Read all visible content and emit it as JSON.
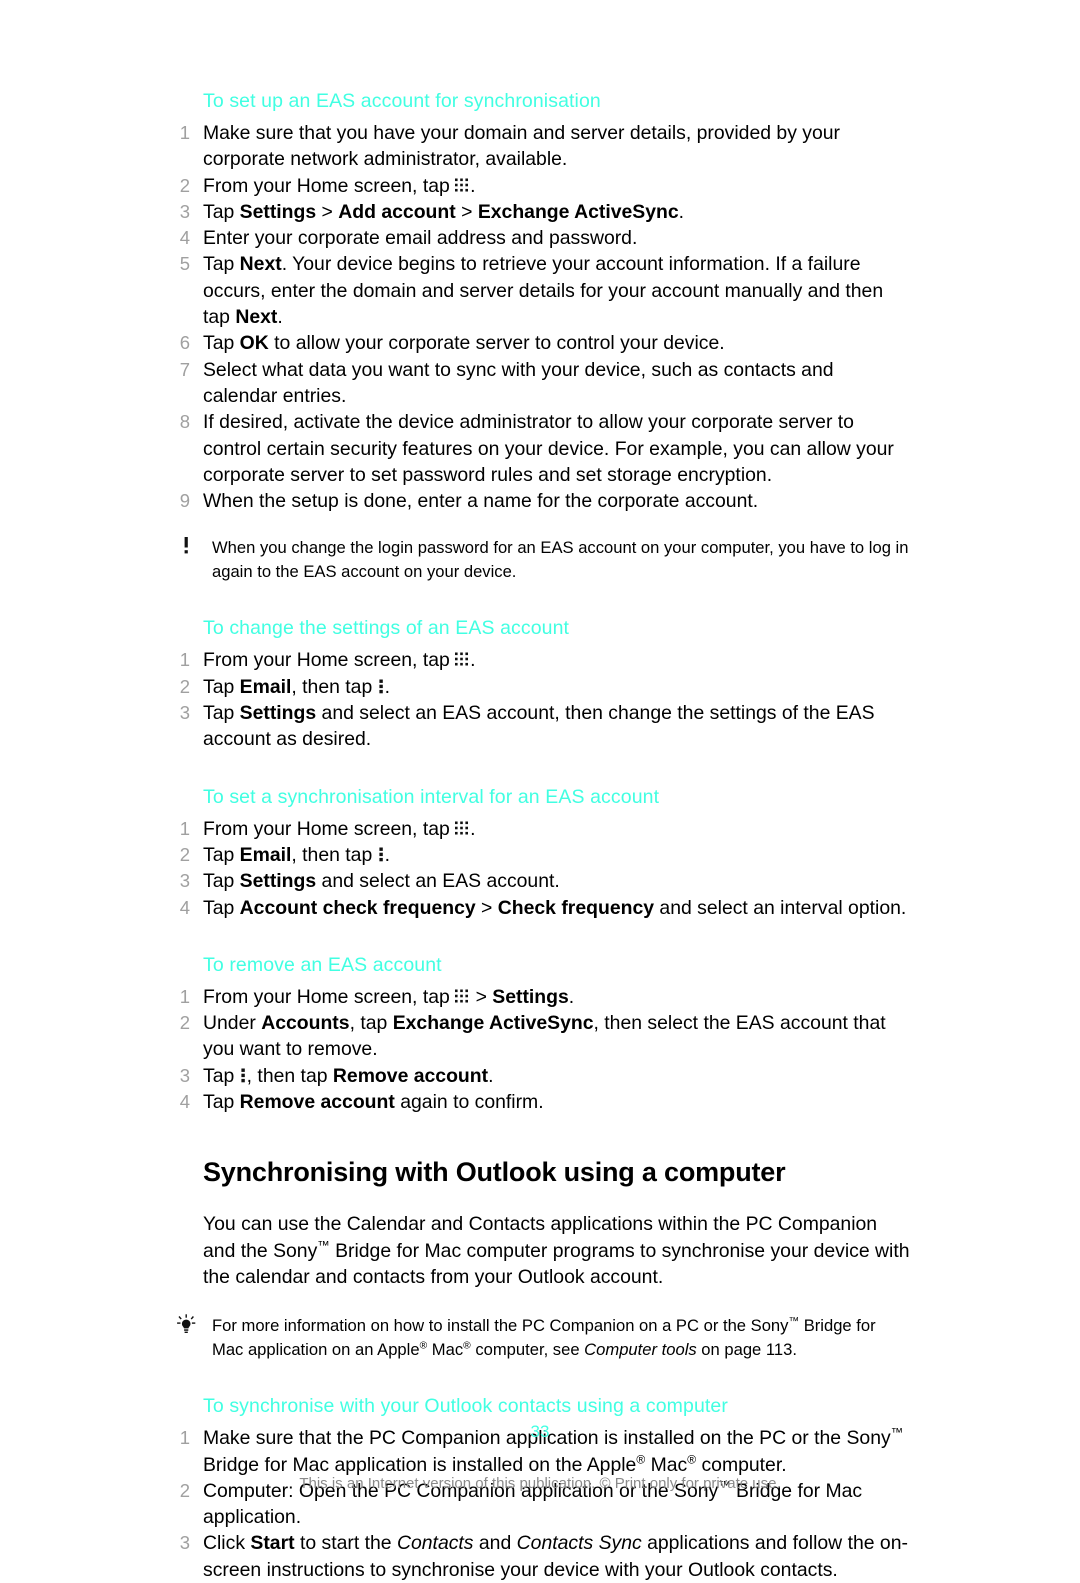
{
  "document": {
    "page_number": "33",
    "footer_note": "This is an Internet version of this publication. © Print only for private use.",
    "accent_color": "#41ffe2",
    "number_color": "#a0a0a0"
  },
  "sections": {
    "eas_setup": {
      "heading": "To set up an EAS account for synchronisation",
      "steps": [
        {
          "num": "1",
          "text": "Make sure that you have your domain and server details, provided by your corporate network administrator, available."
        },
        {
          "num": "2",
          "text": "From your Home screen, tap [app-grid-icon]."
        },
        {
          "num": "3",
          "text": "Tap Settings > Add account > Exchange ActiveSync."
        },
        {
          "num": "4",
          "text": "Enter your corporate email address and password."
        },
        {
          "num": "5",
          "text": "Tap Next. Your device begins to retrieve your account information. If a failure occurs, enter the domain and server details for your account manually and then tap Next."
        },
        {
          "num": "6",
          "text": "Tap OK to allow your corporate server to control your device."
        },
        {
          "num": "7",
          "text": "Select what data you want to sync with your device, such as contacts and calendar entries."
        },
        {
          "num": "8",
          "text": "If desired, activate the device administrator to allow your corporate server to control certain security features on your device. For example, you can allow your corporate server to set password rules and set storage encryption."
        },
        {
          "num": "9",
          "text": "When the setup is done, enter a name for the corporate account."
        }
      ]
    },
    "note_eas_password": {
      "icon": "exclamation-note-icon",
      "text": "When you change the login password for an EAS account on your computer, you have to log in again to the EAS account on your device."
    },
    "eas_change_settings": {
      "heading": "To change the settings of an EAS account",
      "steps": [
        {
          "num": "1",
          "text": "From your Home screen, tap [app-grid-icon]."
        },
        {
          "num": "2",
          "text": "Tap Email, then tap [overflow-menu-icon]."
        },
        {
          "num": "3",
          "text": "Tap Settings and select an EAS account, then change the settings of the EAS account as desired."
        }
      ]
    },
    "eas_sync_interval": {
      "heading": "To set a synchronisation interval for an EAS account",
      "steps": [
        {
          "num": "1",
          "text": "From your Home screen, tap [app-grid-icon]."
        },
        {
          "num": "2",
          "text": "Tap Email, then tap [overflow-menu-icon]."
        },
        {
          "num": "3",
          "text": "Tap Settings and select an EAS account."
        },
        {
          "num": "4",
          "text": "Tap Account check frequency > Check frequency and select an interval option."
        }
      ]
    },
    "eas_remove": {
      "heading": "To remove an EAS account",
      "steps": [
        {
          "num": "1",
          "text": "From your Home screen, tap [app-grid-icon] > Settings."
        },
        {
          "num": "2",
          "text": "Under Accounts, tap Exchange ActiveSync, then select the EAS account that you want to remove."
        },
        {
          "num": "3",
          "text": "Tap [overflow-menu-icon], then tap Remove account."
        },
        {
          "num": "4",
          "text": "Tap Remove account again to confirm."
        }
      ]
    },
    "outlook": {
      "heading": "Synchronising with Outlook using a computer",
      "intro": "You can use the Calendar and Contacts applications within the PC Companion and the Sony™ Bridge for Mac computer programs to synchronise your device with the calendar and contacts from your Outlook account.",
      "tip": {
        "icon": "lightbulb-tip-icon",
        "text": "For more information on how to install the PC Companion on a PC or the Sony™ Bridge for Mac application on an Apple® Mac® computer, see Computer tools on page 113."
      },
      "subheading": "To synchronise with your Outlook contacts using a computer",
      "steps": [
        {
          "num": "1",
          "text": "Make sure that the PC Companion application is installed on the PC or the Sony™ Bridge for Mac application is installed on the Apple® Mac® computer."
        },
        {
          "num": "2",
          "text": "Computer: Open the PC Companion application or the Sony™ Bridge for Mac application."
        },
        {
          "num": "3",
          "text": "Click Start to start the Contacts and Contacts Sync applications and follow the on-screen instructions to synchronise your device with your Outlook contacts."
        }
      ]
    }
  }
}
